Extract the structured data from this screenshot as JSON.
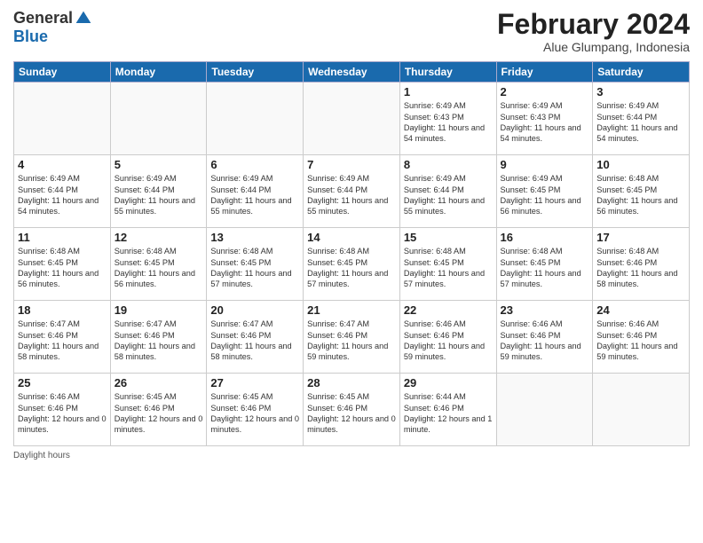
{
  "logo": {
    "general": "General",
    "blue": "Blue"
  },
  "header": {
    "title": "February 2024",
    "subtitle": "Alue Glumpang, Indonesia"
  },
  "days_of_week": [
    "Sunday",
    "Monday",
    "Tuesday",
    "Wednesday",
    "Thursday",
    "Friday",
    "Saturday"
  ],
  "weeks": [
    [
      {
        "day": "",
        "sunrise": "",
        "sunset": "",
        "daylight": ""
      },
      {
        "day": "",
        "sunrise": "",
        "sunset": "",
        "daylight": ""
      },
      {
        "day": "",
        "sunrise": "",
        "sunset": "",
        "daylight": ""
      },
      {
        "day": "",
        "sunrise": "",
        "sunset": "",
        "daylight": ""
      },
      {
        "day": "1",
        "sunrise": "Sunrise: 6:49 AM",
        "sunset": "Sunset: 6:43 PM",
        "daylight": "Daylight: 11 hours and 54 minutes."
      },
      {
        "day": "2",
        "sunrise": "Sunrise: 6:49 AM",
        "sunset": "Sunset: 6:43 PM",
        "daylight": "Daylight: 11 hours and 54 minutes."
      },
      {
        "day": "3",
        "sunrise": "Sunrise: 6:49 AM",
        "sunset": "Sunset: 6:44 PM",
        "daylight": "Daylight: 11 hours and 54 minutes."
      }
    ],
    [
      {
        "day": "4",
        "sunrise": "Sunrise: 6:49 AM",
        "sunset": "Sunset: 6:44 PM",
        "daylight": "Daylight: 11 hours and 54 minutes."
      },
      {
        "day": "5",
        "sunrise": "Sunrise: 6:49 AM",
        "sunset": "Sunset: 6:44 PM",
        "daylight": "Daylight: 11 hours and 55 minutes."
      },
      {
        "day": "6",
        "sunrise": "Sunrise: 6:49 AM",
        "sunset": "Sunset: 6:44 PM",
        "daylight": "Daylight: 11 hours and 55 minutes."
      },
      {
        "day": "7",
        "sunrise": "Sunrise: 6:49 AM",
        "sunset": "Sunset: 6:44 PM",
        "daylight": "Daylight: 11 hours and 55 minutes."
      },
      {
        "day": "8",
        "sunrise": "Sunrise: 6:49 AM",
        "sunset": "Sunset: 6:44 PM",
        "daylight": "Daylight: 11 hours and 55 minutes."
      },
      {
        "day": "9",
        "sunrise": "Sunrise: 6:49 AM",
        "sunset": "Sunset: 6:45 PM",
        "daylight": "Daylight: 11 hours and 56 minutes."
      },
      {
        "day": "10",
        "sunrise": "Sunrise: 6:48 AM",
        "sunset": "Sunset: 6:45 PM",
        "daylight": "Daylight: 11 hours and 56 minutes."
      }
    ],
    [
      {
        "day": "11",
        "sunrise": "Sunrise: 6:48 AM",
        "sunset": "Sunset: 6:45 PM",
        "daylight": "Daylight: 11 hours and 56 minutes."
      },
      {
        "day": "12",
        "sunrise": "Sunrise: 6:48 AM",
        "sunset": "Sunset: 6:45 PM",
        "daylight": "Daylight: 11 hours and 56 minutes."
      },
      {
        "day": "13",
        "sunrise": "Sunrise: 6:48 AM",
        "sunset": "Sunset: 6:45 PM",
        "daylight": "Daylight: 11 hours and 57 minutes."
      },
      {
        "day": "14",
        "sunrise": "Sunrise: 6:48 AM",
        "sunset": "Sunset: 6:45 PM",
        "daylight": "Daylight: 11 hours and 57 minutes."
      },
      {
        "day": "15",
        "sunrise": "Sunrise: 6:48 AM",
        "sunset": "Sunset: 6:45 PM",
        "daylight": "Daylight: 11 hours and 57 minutes."
      },
      {
        "day": "16",
        "sunrise": "Sunrise: 6:48 AM",
        "sunset": "Sunset: 6:45 PM",
        "daylight": "Daylight: 11 hours and 57 minutes."
      },
      {
        "day": "17",
        "sunrise": "Sunrise: 6:48 AM",
        "sunset": "Sunset: 6:46 PM",
        "daylight": "Daylight: 11 hours and 58 minutes."
      }
    ],
    [
      {
        "day": "18",
        "sunrise": "Sunrise: 6:47 AM",
        "sunset": "Sunset: 6:46 PM",
        "daylight": "Daylight: 11 hours and 58 minutes."
      },
      {
        "day": "19",
        "sunrise": "Sunrise: 6:47 AM",
        "sunset": "Sunset: 6:46 PM",
        "daylight": "Daylight: 11 hours and 58 minutes."
      },
      {
        "day": "20",
        "sunrise": "Sunrise: 6:47 AM",
        "sunset": "Sunset: 6:46 PM",
        "daylight": "Daylight: 11 hours and 58 minutes."
      },
      {
        "day": "21",
        "sunrise": "Sunrise: 6:47 AM",
        "sunset": "Sunset: 6:46 PM",
        "daylight": "Daylight: 11 hours and 59 minutes."
      },
      {
        "day": "22",
        "sunrise": "Sunrise: 6:46 AM",
        "sunset": "Sunset: 6:46 PM",
        "daylight": "Daylight: 11 hours and 59 minutes."
      },
      {
        "day": "23",
        "sunrise": "Sunrise: 6:46 AM",
        "sunset": "Sunset: 6:46 PM",
        "daylight": "Daylight: 11 hours and 59 minutes."
      },
      {
        "day": "24",
        "sunrise": "Sunrise: 6:46 AM",
        "sunset": "Sunset: 6:46 PM",
        "daylight": "Daylight: 11 hours and 59 minutes."
      }
    ],
    [
      {
        "day": "25",
        "sunrise": "Sunrise: 6:46 AM",
        "sunset": "Sunset: 6:46 PM",
        "daylight": "Daylight: 12 hours and 0 minutes."
      },
      {
        "day": "26",
        "sunrise": "Sunrise: 6:45 AM",
        "sunset": "Sunset: 6:46 PM",
        "daylight": "Daylight: 12 hours and 0 minutes."
      },
      {
        "day": "27",
        "sunrise": "Sunrise: 6:45 AM",
        "sunset": "Sunset: 6:46 PM",
        "daylight": "Daylight: 12 hours and 0 minutes."
      },
      {
        "day": "28",
        "sunrise": "Sunrise: 6:45 AM",
        "sunset": "Sunset: 6:46 PM",
        "daylight": "Daylight: 12 hours and 0 minutes."
      },
      {
        "day": "29",
        "sunrise": "Sunrise: 6:44 AM",
        "sunset": "Sunset: 6:46 PM",
        "daylight": "Daylight: 12 hours and 1 minute."
      },
      {
        "day": "",
        "sunrise": "",
        "sunset": "",
        "daylight": ""
      },
      {
        "day": "",
        "sunrise": "",
        "sunset": "",
        "daylight": ""
      }
    ]
  ],
  "footer": {
    "note": "Daylight hours"
  }
}
